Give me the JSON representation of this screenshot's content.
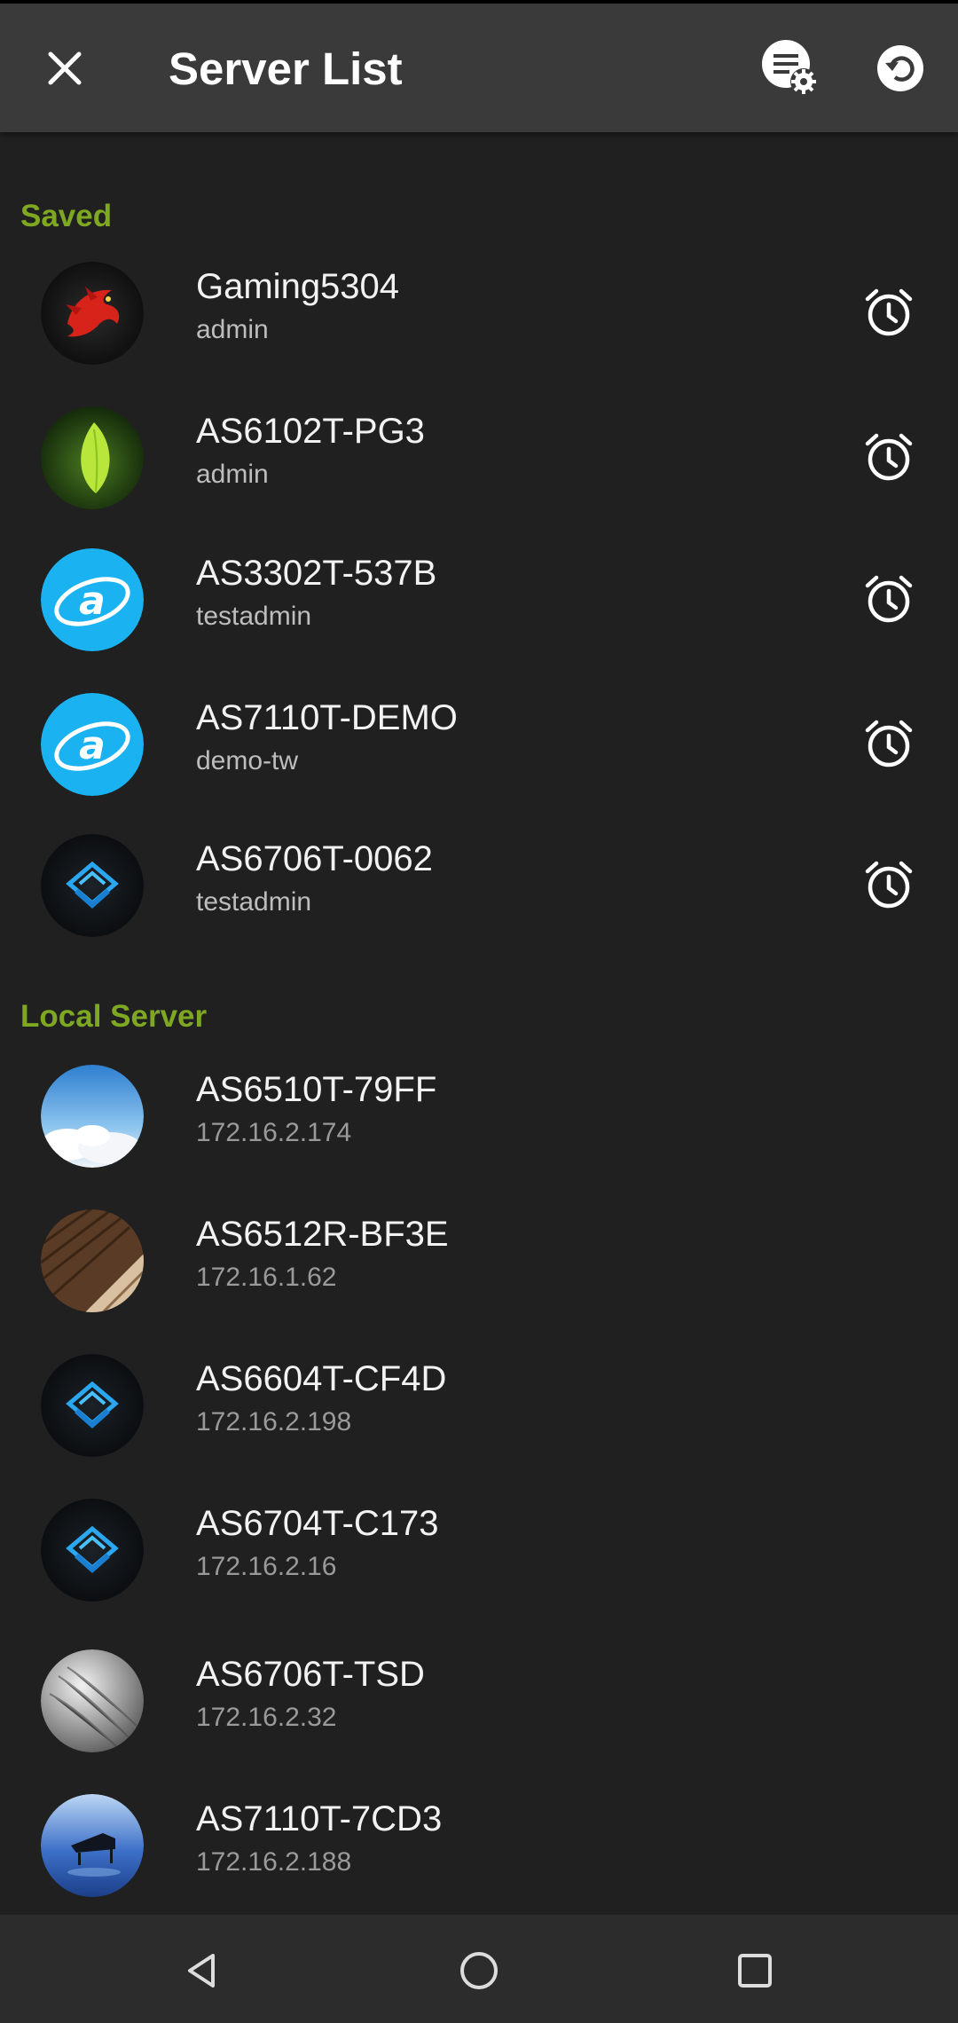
{
  "header": {
    "title": "Server List"
  },
  "sections": {
    "saved": "Saved",
    "local": "Local Server"
  },
  "saved": [
    {
      "name": "Gaming5304",
      "user": "admin",
      "avatar": "dragon"
    },
    {
      "name": "AS6102T-PG3",
      "user": "admin",
      "avatar": "leaf"
    },
    {
      "name": "AS3302T-537B",
      "user": "testadmin",
      "avatar": "asustor-logo"
    },
    {
      "name": "AS7110T-DEMO",
      "user": "demo-tw",
      "avatar": "asustor-logo"
    },
    {
      "name": "AS6706T-0062",
      "user": "testadmin",
      "avatar": "layers-logo"
    }
  ],
  "local": [
    {
      "name": "AS6510T-79FF",
      "ip": "172.16.2.174",
      "avatar": "sky"
    },
    {
      "name": "AS6512R-BF3E",
      "ip": "172.16.1.62",
      "avatar": "wood"
    },
    {
      "name": "AS6604T-CF4D",
      "ip": "172.16.2.198",
      "avatar": "layers-logo"
    },
    {
      "name": "AS6704T-C173",
      "ip": "172.16.2.16",
      "avatar": "layers-logo"
    },
    {
      "name": "AS6706T-TSD",
      "ip": "172.16.2.32",
      "avatar": "feather"
    },
    {
      "name": "AS7110T-7CD3",
      "ip": "172.16.2.188",
      "avatar": "piano"
    }
  ],
  "colors": {
    "accent": "#7fa822",
    "appbar": "#3a3a3a",
    "background": "#202020",
    "asustor_blue": "#1ab2f0"
  },
  "icons": [
    "close-icon",
    "server-settings-icon",
    "refresh-icon",
    "alarm-icon",
    "back-icon",
    "home-icon",
    "recents-icon"
  ]
}
